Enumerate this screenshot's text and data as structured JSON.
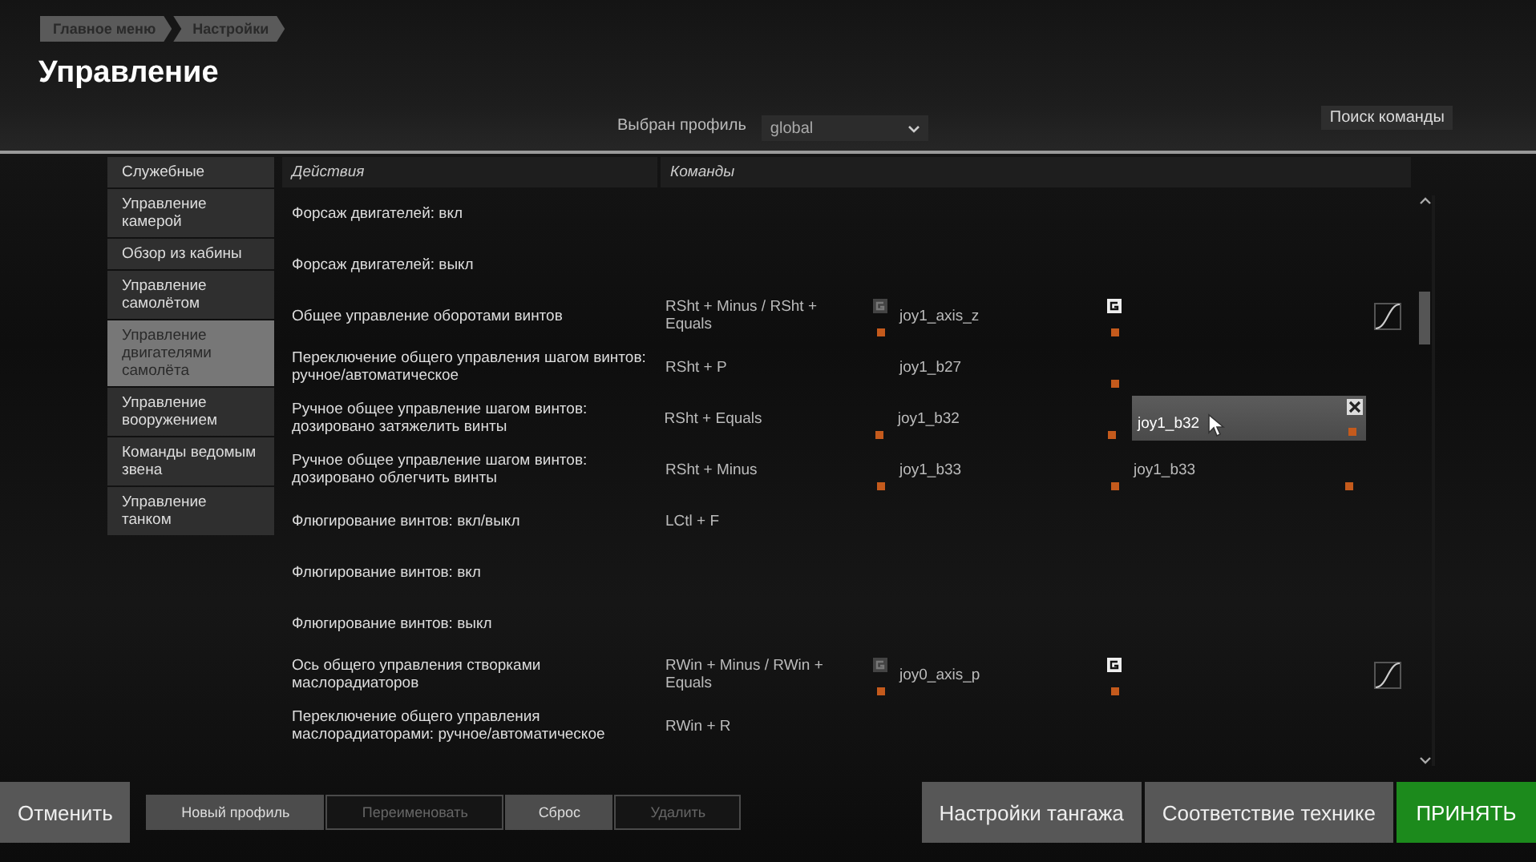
{
  "breadcrumb": [
    {
      "label": "Главное меню"
    },
    {
      "label": "Настройки"
    }
  ],
  "title": "Управление",
  "profile": {
    "label": "Выбран профиль",
    "value": "global"
  },
  "search_button": "Поиск команды",
  "sidebar": {
    "items": [
      {
        "label": "Служебные",
        "selected": false
      },
      {
        "label": "Управление камерой",
        "selected": false
      },
      {
        "label": "Обзор из кабины",
        "selected": false
      },
      {
        "label": "Управление самолётом",
        "selected": false
      },
      {
        "label": "Управление двигателями самолёта",
        "selected": true
      },
      {
        "label": "Управление вооружением",
        "selected": false
      },
      {
        "label": "Команды ведомым звена",
        "selected": false
      },
      {
        "label": "Управление танком",
        "selected": false
      }
    ]
  },
  "table": {
    "columns": [
      "Действия",
      "Команды"
    ],
    "rows": [
      {
        "action": "Форсаж двигателей: вкл",
        "kind": "button",
        "bindings": []
      },
      {
        "action": "Форсаж двигателей: выкл",
        "kind": "button",
        "bindings": []
      },
      {
        "action": "Общее управление оборотами винтов",
        "kind": "axis",
        "bindings": [
          {
            "text": "RSht + Minus / RSht + Equals",
            "modified": true,
            "selected": false,
            "toggle_on": false
          },
          {
            "text": "joy1_axis_z",
            "modified": true,
            "selected": false,
            "toggle_on": true
          }
        ]
      },
      {
        "action": "Переключение общего управления шагом винтов: ручное/автоматическое",
        "kind": "button",
        "bindings": [
          {
            "text": "RSht + P",
            "modified": false,
            "selected": false
          },
          {
            "text": "joy1_b27",
            "modified": true,
            "selected": false
          }
        ]
      },
      {
        "action": "Ручное общее управление шагом винтов: дозировано затяжелить винты",
        "kind": "button",
        "bindings": [
          {
            "text": "RSht + Equals",
            "modified": true,
            "selected": false
          },
          {
            "text": "joy1_b32",
            "modified": true,
            "selected": false
          },
          {
            "text": "joy1_b32",
            "modified": true,
            "selected": true
          }
        ]
      },
      {
        "action": "Ручное общее управление шагом винтов: дозировано облегчить винты",
        "kind": "button",
        "bindings": [
          {
            "text": "RSht + Minus",
            "modified": true,
            "selected": false
          },
          {
            "text": "joy1_b33",
            "modified": true,
            "selected": false
          },
          {
            "text": "joy1_b33",
            "modified": true,
            "selected": false
          }
        ]
      },
      {
        "action": "Флюгирование винтов: вкл/выкл",
        "kind": "button",
        "bindings": [
          {
            "text": "LCtl + F",
            "modified": false,
            "selected": false
          }
        ]
      },
      {
        "action": "Флюгирование винтов: вкл",
        "kind": "button",
        "bindings": []
      },
      {
        "action": "Флюгирование винтов: выкл",
        "kind": "button",
        "bindings": []
      },
      {
        "action": "Ось общего управления створками маслорадиаторов",
        "kind": "axis",
        "bindings": [
          {
            "text": "RWin + Minus / RWin + Equals",
            "modified": true,
            "selected": false,
            "toggle_on": false
          },
          {
            "text": "joy0_axis_p",
            "modified": true,
            "selected": false,
            "toggle_on": true
          }
        ]
      },
      {
        "action": "Переключение общего управления маслорадиаторами: ручное/автоматическое",
        "kind": "button",
        "bindings": [
          {
            "text": "RWin + R",
            "modified": false,
            "selected": false
          }
        ]
      }
    ]
  },
  "footer": {
    "left": [
      {
        "label": "Отменить",
        "disabled": false
      }
    ],
    "profile_buttons": [
      {
        "label": "Новый профиль",
        "disabled": false
      },
      {
        "label": "Переименовать",
        "disabled": true
      },
      {
        "label": "Сброс",
        "disabled": false
      },
      {
        "label": "Удалить",
        "disabled": true
      }
    ],
    "right": [
      {
        "label": "Настройки тангажа",
        "kind": "normal"
      },
      {
        "label": "Соответствие технике",
        "kind": "normal"
      },
      {
        "label": "ПРИНЯТЬ",
        "kind": "accept"
      }
    ]
  }
}
